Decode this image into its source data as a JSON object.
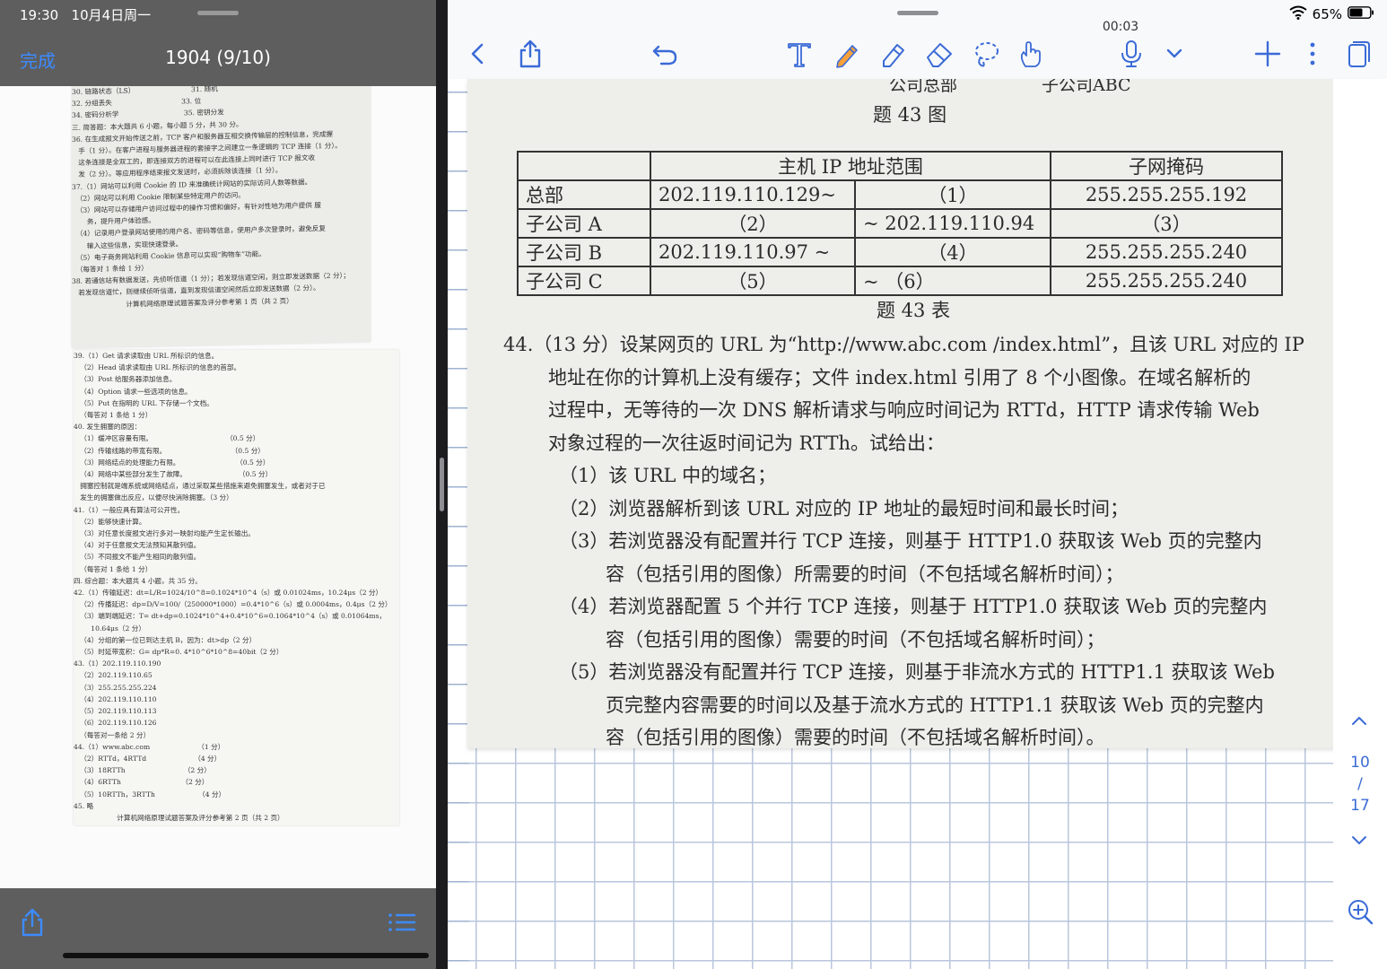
{
  "left_pane": {
    "status": {
      "time": "19:30",
      "date": "10月4日周一"
    },
    "done_label": "完成",
    "doc_title": "1904 (9/10)",
    "scan_page_1": [
      "30. 链路状态（LS）                          31. 随机",
      "32. 分组丢失                                33. 位",
      "34. 密码分析学                              35. 密钥分发",
      "三. 简答题：本大题共 6 小题，每小题 5 分，共 30 分。",
      "36. 在生成报文开始传送之前，TCP 客户和服务器互相交换传输层的控制信息，完成握",
      "   手（1 分）。在客户进程与服务器进程的套接字之间建立一条逻辑的 TCP 连接（1 分）。",
      "   这条连接是全双工的，即连接双方的进程可以在此连接上同时进行 TCP 报文收",
      "   发（2 分）。等应用程序结束报文发送时，必须拆除该连接（1 分）。",
      "37.（1）网站可以利用 Cookie 的 ID 来准确统计网站的实际访问人数等数据。",
      "  （2）网站可以利用 Cookie 限制某些特定用户的访问。",
      "  （3）网站可以存储用户访问过程中的操作习惯和偏好，有针对性地为用户提供 服",
      "       务，提升用户体验感。",
      "  （4）记录用户登录网站使用的用户名、密码等信息，使用户多次登录时，避免反复",
      "       输入这些信息，实现快速登录。",
      "  （5）电子商务网站利用 Cookie 信息可以实现“购物车”功能。",
      "  （每答对 1 条给 1 分）",
      "38. 若通信站有数据发送，先侦听信道（1 分）；若发现信道空闲，则立即发送数据（2 分）；",
      "   若发现信道忙，则继续侦听信道，直到发现信道空闲然后立即发送数据（2 分）。",
      "                         计算机网络原理试题答案及评分参考第 1 页（共 2 页）"
    ],
    "scan_page_2": [
      "39.（1）Get 请求读取由 URL 所标识的信息。",
      "   （2）Head 请求读取由 URL 所标识的信息的首部。",
      "   （3）Post 给服务器添加信息。",
      "   （4）Option 请求一些选项的信息。",
      "   （5）Put 在指明的 URL 下存储一个文档。",
      "   （每答对 1 条给 1 分）",
      "40. 发生拥塞的原因：",
      "   （1）缓冲区容量有限。                                  （0.5 分）",
      "   （2）传输线路的带宽有限。                              （0.5 分）",
      "   （3）网络结点的处理能力有限。                          （0.5 分）",
      "   （4）网络中某些部分发生了故障。                        （0.5 分）",
      "   拥塞控制就是端系统或网络结点，通过采取某些措施来避免拥塞发生，或者对于已",
      "   发生的拥塞做出反应，以便尽快消除拥塞。（3 分）",
      "41.（1）一般应具有算法可公开性。",
      "   （2）能够快速计算。",
      "   （3）对任意长度报文进行多对一映射均能产生定长输出。",
      "   （4）对于任意报文无法预知其散列值。",
      "   （5）不同报文不能产生相同的散列值。",
      "   （每答对 1 条给 1 分）",
      "四. 综合题：本大题共 4 小题，共 35 分。",
      "42.（1）传输延迟：dt=L/R=1024/10^8=0.1024*10^4（s）或 0.01024ms，10.24μs（2 分）",
      "   （2）传播延迟：dp=D/V=100/（250000*1000）=0.4*10^6（s）或 0.0004ms，0.4μs（2 分）",
      "   （3）端到端延迟：T= dt+dp=0.1024*10^4+0.4*10^6=0.1064*10^4（s）或 0.01064ms，",
      "        10.64μs（2 分）",
      "   （4）分组的第一位已到达主机 B，因为：dt>dp（2 分）",
      "   （5）时延带宽积：G= dp*R=0. 4*10^6*10^8=40bit（2 分）",
      "43.（1）202.119.110.190",
      "   （2）202.119.110.65",
      "   （3）255.255.255.224",
      "   （4）202.119.110.110",
      "   （5）202.119.110.113",
      "   （6）202.119.110.126",
      "   （每答对一条给 2 分）",
      "44.（1）www.abc.com                      （1 分）",
      "   （2）RTTd，4RTTd                      （4 分）",
      "   （3）18RTTh                           （2 分）",
      "   （4）6RTTh                            （2 分）",
      "   （5）10RTTh，3RTTh                    （4 分）",
      "45. 略",
      "                    计算机网络原理试题答案及评分参考第 2 页（共 2 页）"
    ]
  },
  "right_pane": {
    "timer": "00:03",
    "battery": "65%",
    "figure_heads": [
      "公司总部",
      "子公司ABC"
    ],
    "figure_caption": "题 43 图",
    "table": {
      "headers": [
        "",
        "主机 IP 地址范围",
        "子网掩码"
      ],
      "rows": [
        {
          "name": "总部",
          "from": "202.119.110.129~",
          "to": "（1）",
          "mask": "255.255.255.192"
        },
        {
          "name": "子公司 A",
          "from": "（2）",
          "to": "~      202.119.110.94",
          "mask": "（3）"
        },
        {
          "name": "子公司 B",
          "from": "202.119.110.97 ~",
          "to": "（4）",
          "mask": "255.255.255.240"
        },
        {
          "name": "子公司 C",
          "from": "（5）",
          "to": "~       （6）",
          "mask": "255.255.255.240"
        }
      ]
    },
    "table_caption": "题 43 表",
    "question_lines": [
      "44.（13 分）设某网页的 URL 为“http://www.abc.com /index.html”，且该 URL 对应的 IP",
      "地址在你的计算机上没有缓存；文件 index.html 引用了 8 个小图像。在域名解析的",
      "过程中，无等待的一次 DNS 解析请求与响应时间记为 RTTd，HTTP 请求传输 Web",
      "对象过程的一次往返时间记为 RTTh。试给出：",
      "（1）该 URL 中的域名；",
      "（2）浏览器解析到该 URL 对应的 IP 地址的最短时间和最长时间；",
      "（3）若浏览器没有配置并行 TCP 连接，则基于 HTTP1.0 获取该 Web 页的完整内",
      "容（包括引用的图像）所需要的时间（不包括域名解析时间）；",
      "（4）若浏览器配置 5 个并行 TCP 连接，则基于 HTTP1.0 获取该 Web 页的完整内",
      "容（包括引用的图像）需要的时间（不包括域名解析时间）；",
      "（5）若浏览器没有配置并行 TCP 连接，则基于非流水方式的 HTTP1.1 获取该 Web",
      "页完整内容需要的时间以及基于流水方式的 HTTP1.1 获取该 Web 页的完整内",
      "容（包括引用的图像）需要的时间（不包括域名解析时间）。"
    ],
    "page_indicator": {
      "current": "10",
      "sep": "/",
      "total": "17"
    }
  },
  "icons": {
    "back": "chevron-left-icon",
    "share": "share-icon",
    "undo": "undo-icon",
    "text": "text-tool-icon",
    "pen": "pen-icon",
    "highlighter": "highlighter-icon",
    "eraser": "eraser-icon",
    "lasso": "lasso-icon",
    "hand": "hand-touch-icon",
    "mic": "microphone-icon",
    "add": "plus-icon",
    "more": "more-icon",
    "pages": "pages-icon"
  },
  "colors": {
    "accent": "#3d8bff",
    "toolbar_icon": "#3b6bd6",
    "pen_orange": "#f6a13a"
  }
}
